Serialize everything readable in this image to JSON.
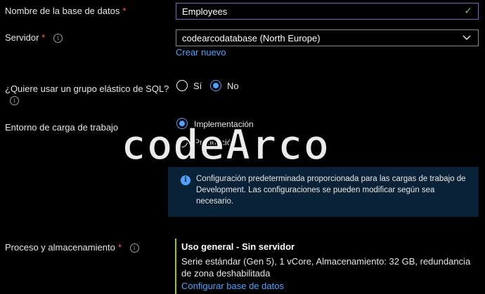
{
  "form": {
    "database_name": {
      "label": "Nombre de la base de datos",
      "required_mark": "*",
      "value": "Employees"
    },
    "server": {
      "label": "Servidor",
      "required_mark": "*",
      "value": "codearcodatabase (North Europe)",
      "create_link": "Crear nuevo"
    },
    "elastic_pool": {
      "label": "¿Quiere usar un grupo elástico de SQL?",
      "options": [
        "Sí",
        "No"
      ],
      "selected": "No"
    },
    "workload": {
      "label": "Entorno de carga de trabajo",
      "options": [
        "Implementación",
        "Producción"
      ],
      "selected": "Implementación",
      "info_text": "Configuración predeterminada proporcionada para las cargas de trabajo de Development. Las configuraciones se pueden modificar según sea necesario."
    },
    "compute": {
      "label": "Proceso y almacenamiento",
      "required_mark": "*",
      "tier": "Uso general - Sin servidor",
      "description": "Serie estándar (Gen 5), 1 vCore, Almacenamiento: 32 GB, redundancia de zona deshabilitada",
      "configure_link": "Configurar base de datos"
    }
  },
  "watermark": "codeArco",
  "colors": {
    "background": "#000000",
    "accent": "#4da3ff",
    "required": "#ff5c5c",
    "valid_check": "#6ccb5f",
    "compute_bar": "#a4c400",
    "infobox_bg": "#0a2237"
  }
}
